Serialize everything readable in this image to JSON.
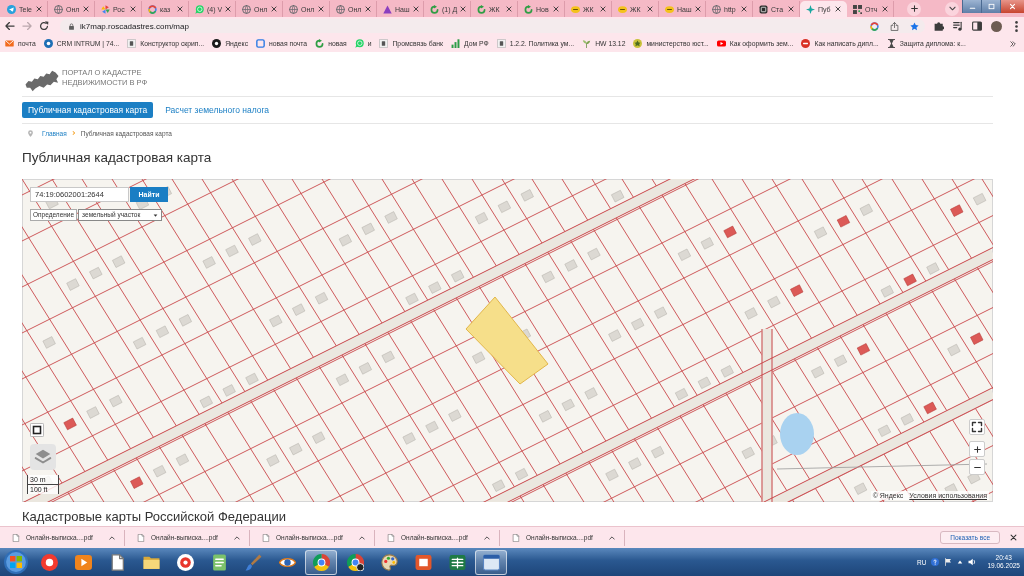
{
  "window": {
    "tabs": [
      {
        "title": "Tele",
        "selected": false
      },
      {
        "title": "Онл",
        "selected": false
      },
      {
        "title": "Рос",
        "selected": false
      },
      {
        "title": "каз",
        "selected": false
      },
      {
        "title": "(4) V",
        "selected": false
      },
      {
        "title": "Онл",
        "selected": false
      },
      {
        "title": "Онл",
        "selected": false
      },
      {
        "title": "Онл",
        "selected": false
      },
      {
        "title": "Наш",
        "selected": false
      },
      {
        "title": "(1) Д",
        "selected": false
      },
      {
        "title": "ЖК",
        "selected": false
      },
      {
        "title": "Нов",
        "selected": false
      },
      {
        "title": "ЖК",
        "selected": false
      },
      {
        "title": "ЖК",
        "selected": false
      },
      {
        "title": "Наш",
        "selected": false
      },
      {
        "title": "http",
        "selected": false
      },
      {
        "title": "Ста",
        "selected": false
      },
      {
        "title": "Пуб",
        "selected": true
      },
      {
        "title": "Отч",
        "selected": false
      }
    ]
  },
  "toolbar": {
    "url": "ik7map.roscadastres.com/map",
    "forward_disabled": true,
    "bookmarked": true
  },
  "bookmarks": [
    "почта",
    "CRM INTRUM | 74...",
    "Конструктор скрип...",
    "Яндекс",
    "новая почта",
    "новая",
    "и",
    "Промсвязь банк",
    "Дом РФ",
    "1.2.2. Политика ум...",
    "HW 13.12",
    "министерство юст...",
    "Как оформить зем...",
    "Как написать дипл...",
    "Защита диплома: к..."
  ],
  "page": {
    "logo": [
      "ПОРТАЛ О КАДАСТРЕ",
      "НЕДВИЖИМОСТИ В РФ"
    ],
    "nav": [
      {
        "label": "Публичная кадастровая карта",
        "selected": true
      },
      {
        "label": "Расчет земельного налога",
        "selected": false
      }
    ],
    "breadcrumb": [
      {
        "label": "Главная",
        "kind": "link"
      },
      {
        "label": "Публичная кадастровая карта",
        "kind": "current"
      }
    ],
    "title": "Публичная кадастровая карта",
    "map": {
      "search": {
        "value": "74:19:0602001:2644",
        "button": "Найти"
      },
      "mode": {
        "label": "Определение",
        "value": "земельный участок"
      },
      "scale": [
        "30 m",
        "100 ft"
      ],
      "attribution": "© Яндекс",
      "terms": "Условия использования"
    },
    "section_title": "Кадастровые карты Российской Федерации"
  },
  "downloads": {
    "files": [
      "Онлайн-выписка....pdf",
      "Онлайн-выписка....pdf",
      "Онлайн-выписка....pdf",
      "Онлайн-выписка....pdf",
      "Онлайн-выписка....pdf"
    ],
    "show_all": "Показать все"
  },
  "taskbar": {
    "apps": [
      {
        "active": false
      },
      {
        "active": false
      },
      {
        "active": false
      },
      {
        "active": false
      },
      {
        "active": false
      },
      {
        "active": false
      },
      {
        "active": false
      },
      {
        "active": false
      },
      {
        "active": true
      },
      {
        "active": false
      },
      {
        "active": false
      },
      {
        "active": false
      },
      {
        "active": false
      },
      {
        "active": true
      }
    ],
    "language": "RU",
    "time": "20:43",
    "date": "19.06.2025"
  }
}
